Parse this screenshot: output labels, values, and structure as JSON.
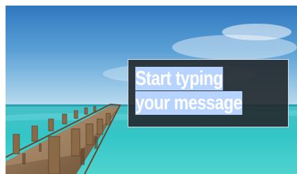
{
  "editor": {
    "placeholder_lines": [
      "Start typing",
      "your message"
    ],
    "selection_color": "#b7d3ff",
    "box_color": "#22282c",
    "text_color": "#ffffff"
  },
  "background": {
    "subject": "tropical beach with wooden pier",
    "sky_color": "#5aa0d6",
    "water_color": "#3cc7c7"
  }
}
